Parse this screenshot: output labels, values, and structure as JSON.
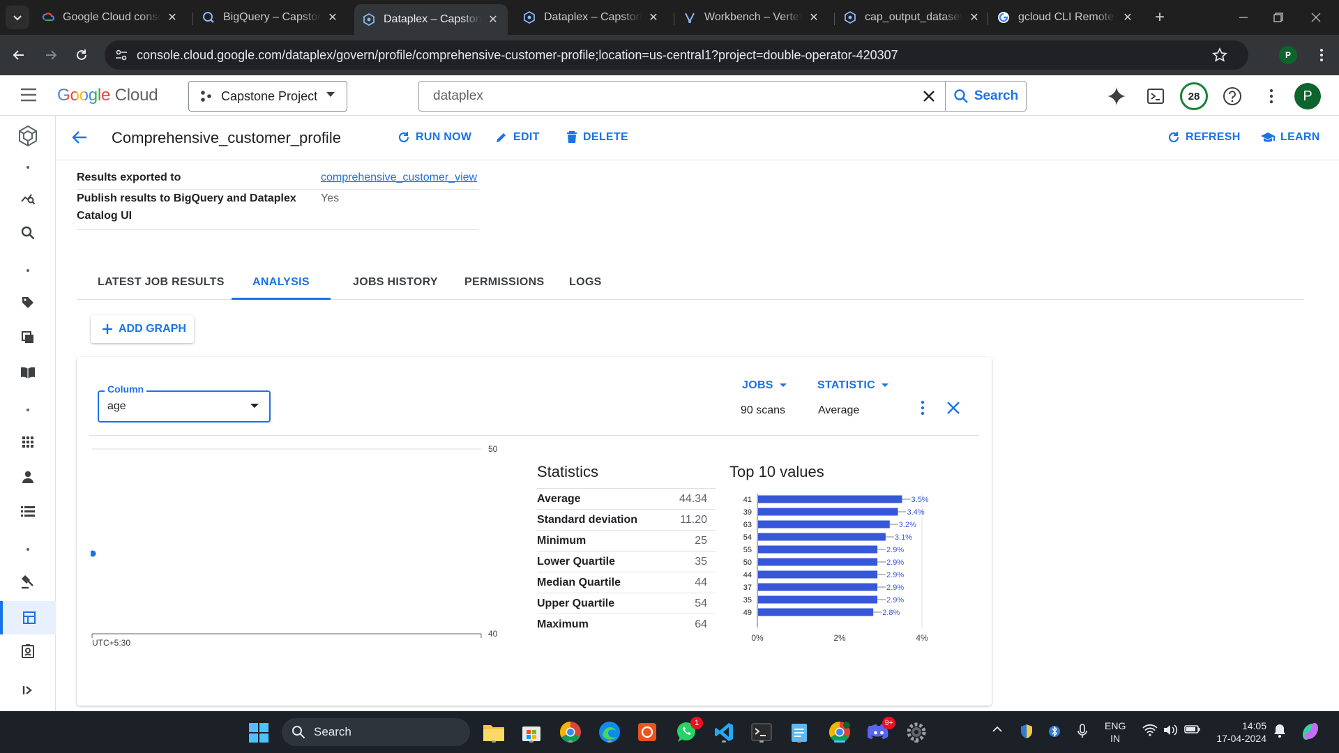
{
  "browser": {
    "tabs": [
      {
        "title": "Google Cloud consol",
        "icon": "google-cloud-icon"
      },
      {
        "title": "BigQuery – Capstone",
        "icon": "bigquery-icon"
      },
      {
        "title": "Dataplex – Capstone",
        "icon": "dataplex-icon",
        "active": true
      },
      {
        "title": "Dataplex – Capstone",
        "icon": "dataplex-icon"
      },
      {
        "title": "Workbench – Vertex",
        "icon": "vertex-icon"
      },
      {
        "title": "cap_output_dataset",
        "icon": "dataplex-icon"
      },
      {
        "title": "gcloud CLI Remote L",
        "icon": "google-icon"
      }
    ],
    "url": "console.cloud.google.com/dataplex/govern/profile/comprehensive-customer-profile;location=us-central1?project=double-operator-420307",
    "profile_initial": "P"
  },
  "header": {
    "logo_google": "Google",
    "logo_cloud": "Cloud",
    "project": "Capstone Project",
    "search_query": "dataplex",
    "search_button": "Search",
    "notifications": "28",
    "avatar_initial": "P"
  },
  "page": {
    "title": "Comprehensive_customer_profile",
    "actions": {
      "run_now": "RUN NOW",
      "edit": "EDIT",
      "delete": "DELETE",
      "refresh": "REFRESH",
      "learn": "LEARN"
    },
    "details": [
      {
        "key": "Results exported to",
        "value": "comprehensive_customer_view",
        "link": true
      },
      {
        "key": "Publish results to BigQuery and Dataplex Catalog UI",
        "value": "Yes",
        "link": false
      }
    ],
    "tabs": [
      "LATEST JOB RESULTS",
      "ANALYSIS",
      "JOBS HISTORY",
      "PERMISSIONS",
      "LOGS"
    ],
    "active_tab": "ANALYSIS",
    "add_graph": "ADD GRAPH"
  },
  "graph_card": {
    "column_label": "Column",
    "column_value": "age",
    "jobs_label": "JOBS",
    "jobs_value": "90 scans",
    "statistic_label": "STATISTIC",
    "statistic_value": "Average",
    "stats_title": "Statistics",
    "stats": [
      {
        "name": "Average",
        "value": "44.34"
      },
      {
        "name": "Standard deviation",
        "value": "11.20"
      },
      {
        "name": "Minimum",
        "value": "25"
      },
      {
        "name": "Lower Quartile",
        "value": "35"
      },
      {
        "name": "Median Quartile",
        "value": "44"
      },
      {
        "name": "Upper Quartile",
        "value": "54"
      },
      {
        "name": "Maximum",
        "value": "64"
      }
    ],
    "top10_title": "Top 10 values"
  },
  "chart_data": [
    {
      "type": "line",
      "points": [
        {
          "y": 44.34
        }
      ],
      "ylim": [
        40,
        50
      ],
      "ytick_labels": [
        "50",
        "40"
      ],
      "xlabel": "UTC+5:30",
      "color": "#1a73e8"
    },
    {
      "type": "bar",
      "orientation": "horizontal",
      "categories": [
        "41",
        "39",
        "63",
        "54",
        "55",
        "50",
        "44",
        "37",
        "35",
        "49"
      ],
      "values": [
        3.5,
        3.4,
        3.2,
        3.1,
        2.9,
        2.9,
        2.9,
        2.9,
        2.9,
        2.8
      ],
      "value_labels": [
        "3.5%",
        "3.4%",
        "3.2%",
        "3.1%",
        "2.9%",
        "2.9%",
        "2.9%",
        "2.9%",
        "2.9%",
        "2.8%"
      ],
      "xlim": [
        0,
        4
      ],
      "xtick_labels": [
        "0%",
        "2%",
        "4%"
      ],
      "color": "#3657d8"
    }
  ],
  "taskbar": {
    "search": "Search",
    "lang": "ENG",
    "region": "IN",
    "time": "14:05",
    "date": "17-04-2024",
    "whatsapp_badge": "1",
    "discord_badge": "9+"
  }
}
